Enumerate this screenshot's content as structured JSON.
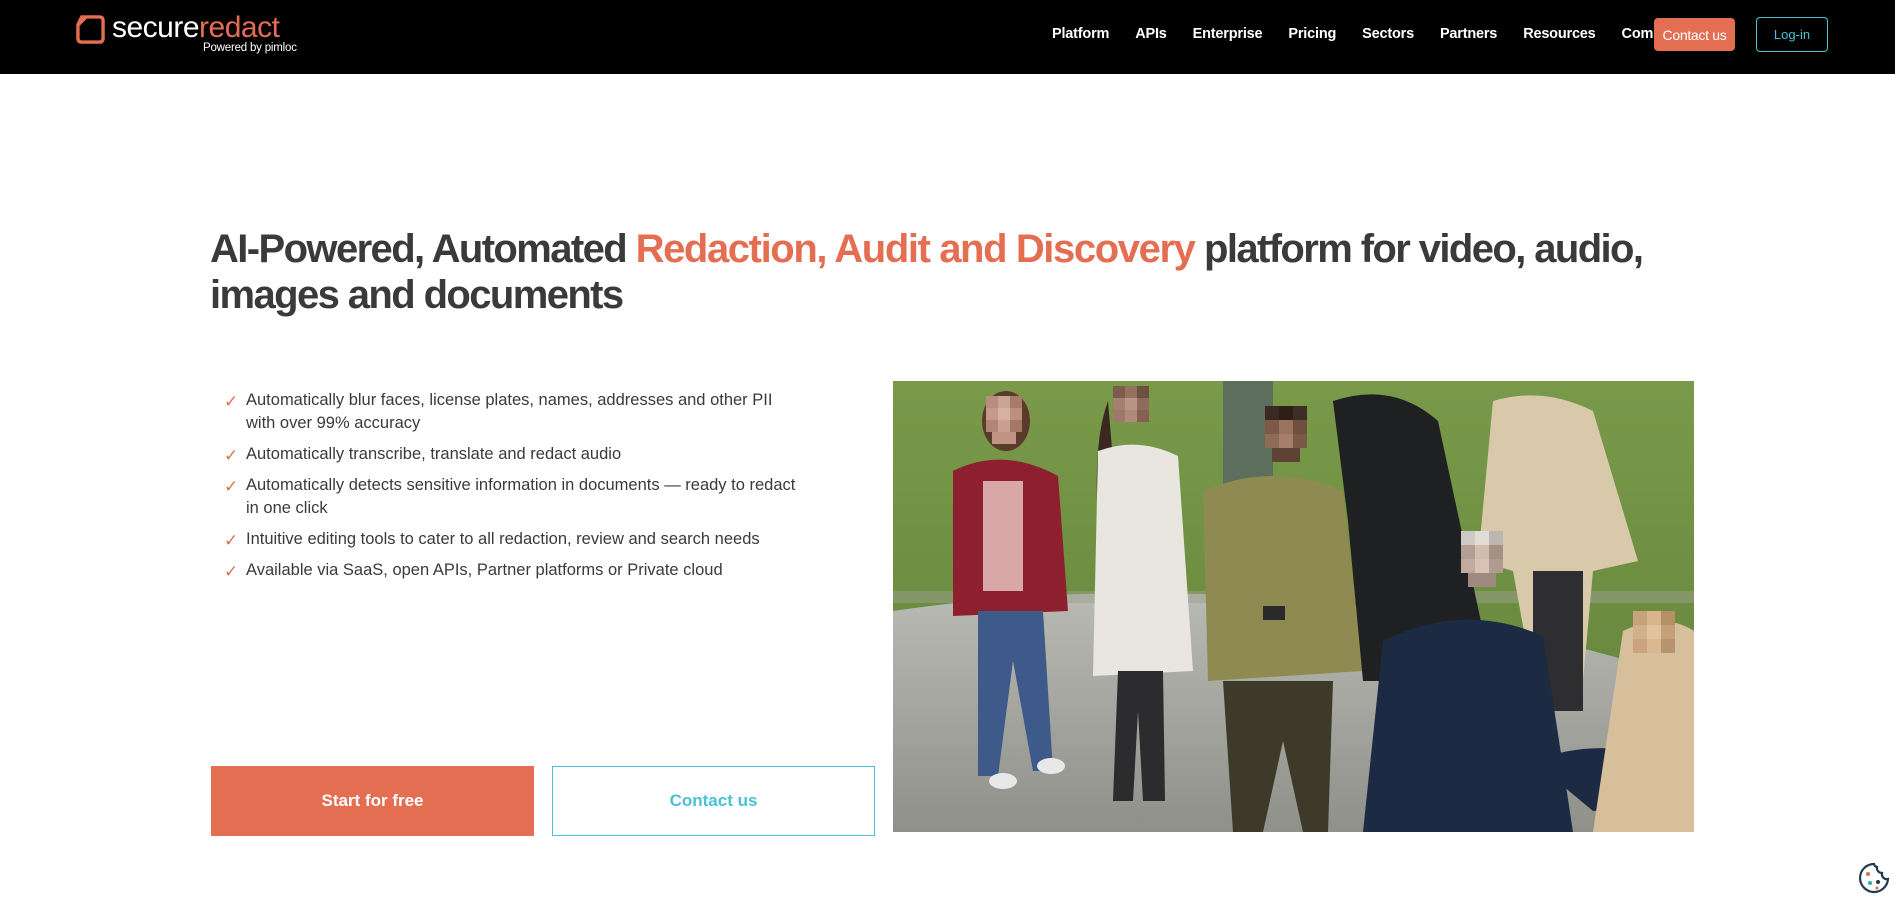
{
  "brand": {
    "name_part1": "secure",
    "name_part2": "redact",
    "tagline": "Powered by pimloc",
    "accent_color": "#e46e52",
    "secondary_color": "#4cc0d6"
  },
  "nav": {
    "items": [
      {
        "label": "Platform"
      },
      {
        "label": "APIs"
      },
      {
        "label": "Enterprise"
      },
      {
        "label": "Pricing"
      },
      {
        "label": "Sectors"
      },
      {
        "label": "Partners"
      },
      {
        "label": "Resources"
      },
      {
        "label": "Company"
      }
    ],
    "contact_label": "Contact us",
    "login_label": "Log-in"
  },
  "hero": {
    "headline_prefix": "AI-Powered, Automated ",
    "headline_accent": "Redaction, Audit and Discovery",
    "headline_suffix": " platform for video, audio, images and documents",
    "features": [
      "Automatically blur faces, license plates, names, addresses and other PII with over 99% accuracy",
      "Automatically transcribe, translate and redact audio",
      "Automatically detects sensitive information in documents — ready to redact in one click",
      "Intuitive editing tools to cater to all redaction, review and search needs",
      "Available via SaaS, open APIs, Partner platforms or Private cloud"
    ],
    "check_symbol": "✓",
    "cta_primary": "Start for free",
    "cta_secondary": "Contact us",
    "image_icon": "photo-of-crowd-with-blurred-faces"
  },
  "cookie": {
    "icon": "cookie-icon"
  }
}
